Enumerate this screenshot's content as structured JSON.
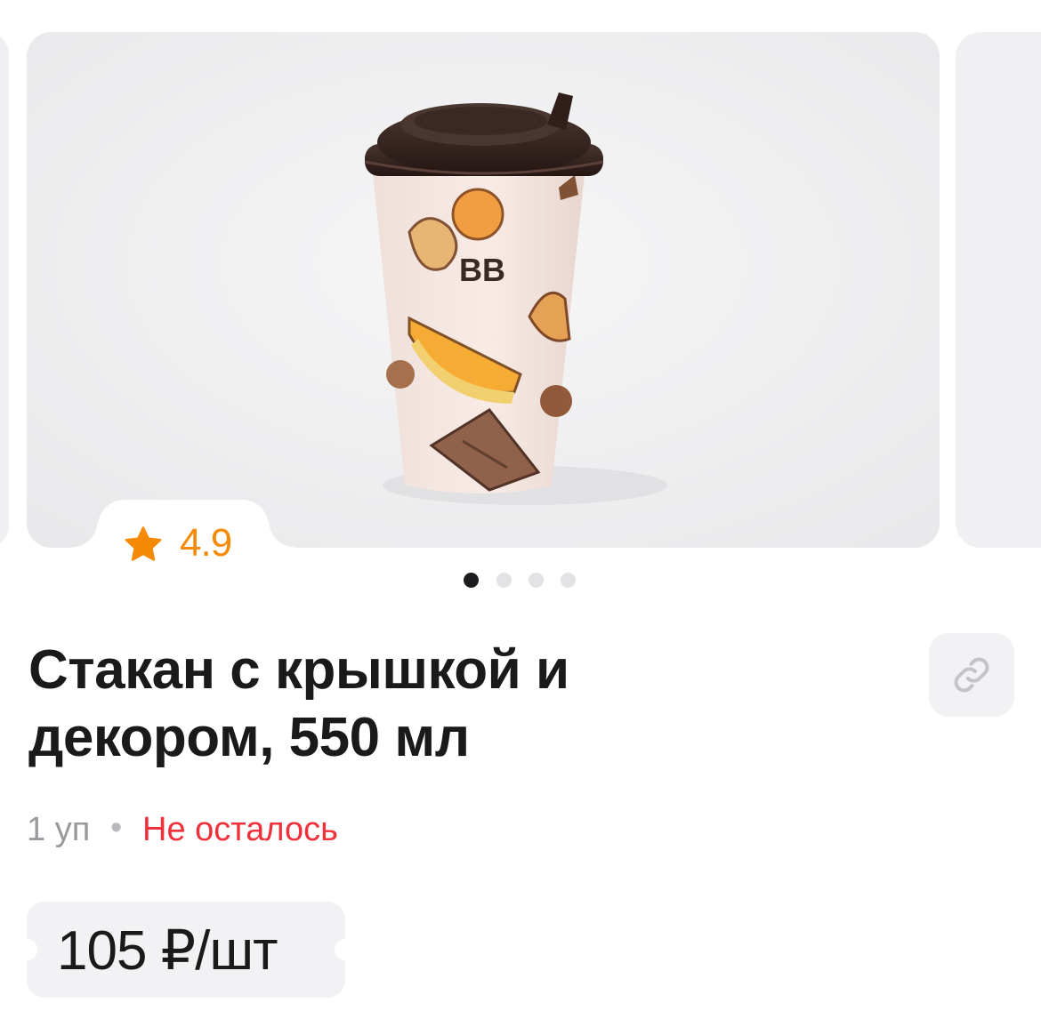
{
  "gallery": {
    "slide_count": 4,
    "active_index": 0,
    "image_alt": "BB cup with lid",
    "cup_logo": "BB"
  },
  "rating": {
    "value": "4.9",
    "icon": "star-icon",
    "color": "#f58a07"
  },
  "product": {
    "title": "Стакан с крышкой и декором, 550 мл",
    "quantity": "1 уп",
    "separator": "•",
    "availability": "Не осталось",
    "availability_color": "#f0303a"
  },
  "actions": {
    "share_link_icon": "link-icon"
  },
  "price": {
    "label": "105 ₽/шт"
  }
}
